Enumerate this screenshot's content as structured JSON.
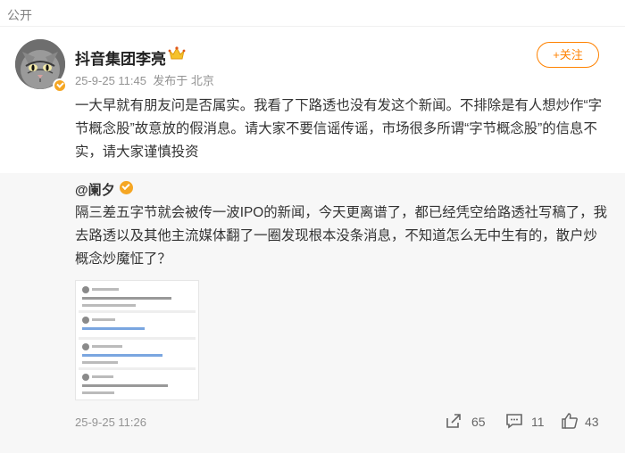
{
  "top_bar": {
    "label": "公开"
  },
  "post": {
    "author": "抖音集团李亮",
    "time": "25-9-25 11:45",
    "source": "发布于 北京",
    "follow_label": "+关注",
    "text": "一大早就有朋友问是否属实。我看了下路透也没有发这个新闻。不排除是有人想炒作“字节概念股”故意放的假消息。请大家不要信谣传谣，市场很多所谓“字节概念股”的信息不实，请大家谨慎投资"
  },
  "repost": {
    "author": "@阑夕",
    "text": "隔三差五字节就会被传一波IPO的新闻，今天更离谱了，都已经凭空给路透社写稿了，我去路透以及其他主流媒体翻了一圈发现根本没条消息，不知道怎么无中生有的，散户炒概念炒魔怔了？",
    "time": "25-9-25 11:26",
    "reposts": "65",
    "comments": "11",
    "likes": "43"
  },
  "colors": {
    "accent": "#ff8200",
    "badge": "#f5a623",
    "meta": "#939393"
  }
}
